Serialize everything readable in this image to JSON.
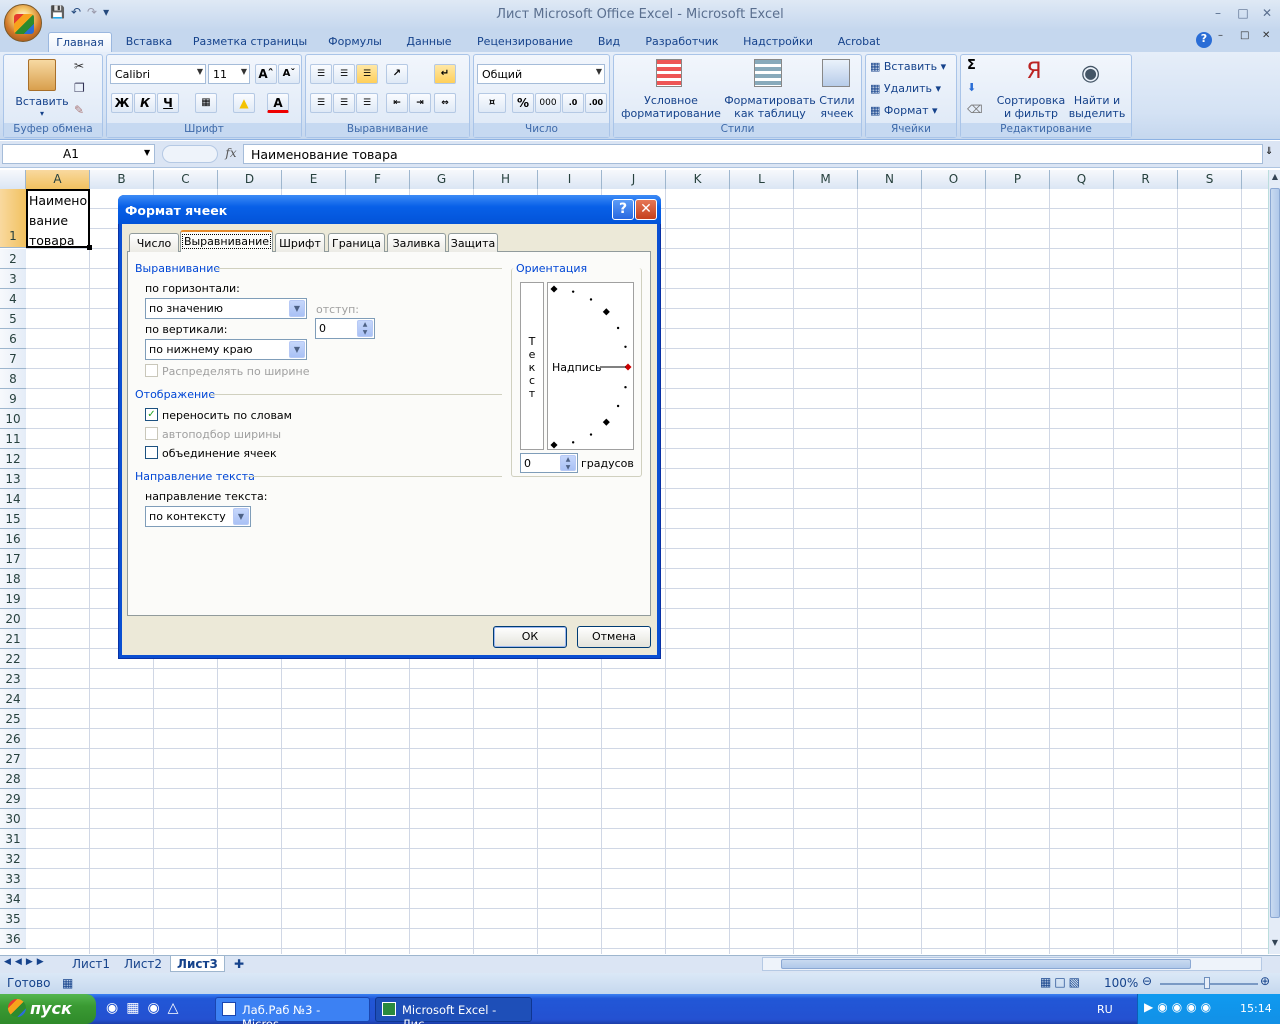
{
  "window": {
    "title": "Лист Microsoft Office Excel - Microsoft Excel"
  },
  "ribbon_tabs": [
    "Главная",
    "Вставка",
    "Разметка страницы",
    "Формулы",
    "Данные",
    "Рецензирование",
    "Вид",
    "Разработчик",
    "Надстройки",
    "Acrobat"
  ],
  "clipboard": {
    "paste": "Вставить",
    "label": "Буфер обмена"
  },
  "font": {
    "name": "Calibri",
    "size": "11",
    "bold": "Ж",
    "italic": "К",
    "underline": "Ч",
    "label": "Шрифт"
  },
  "alignment": {
    "label": "Выравнивание"
  },
  "number": {
    "format": "Общий",
    "percent": "%",
    "thousands": "000",
    "label": "Число"
  },
  "styles": {
    "conditional_l1": "Условное",
    "conditional_l2": "форматирование",
    "table_l1": "Форматировать",
    "table_l2": "как таблицу",
    "cell_l1": "Стили",
    "cell_l2": "ячеек",
    "label": "Стили"
  },
  "cells": {
    "insert": "Вставить",
    "delete": "Удалить",
    "format": "Формат",
    "label": "Ячейки"
  },
  "editing": {
    "sort_l1": "Сортировка",
    "sort_l2": "и фильтр",
    "find_l1": "Найти и",
    "find_l2": "выделить",
    "label": "Редактирование",
    "sum": "Σ"
  },
  "formula_bar": {
    "name": "A1",
    "fx": "fx",
    "value": "Наименование товара"
  },
  "columns": [
    "A",
    "B",
    "C",
    "D",
    "E",
    "F",
    "G",
    "H",
    "I",
    "J",
    "K",
    "L",
    "M",
    "N",
    "O",
    "P",
    "Q",
    "R",
    "S"
  ],
  "rows": [
    "1",
    "2",
    "3",
    "4",
    "5",
    "6",
    "7",
    "8",
    "9",
    "10",
    "11",
    "12",
    "13",
    "14",
    "15",
    "16",
    "17",
    "18",
    "19",
    "20",
    "21",
    "22",
    "23",
    "24",
    "25",
    "26",
    "27",
    "28",
    "29",
    "30",
    "31",
    "32",
    "33",
    "34",
    "35",
    "36"
  ],
  "cell_a1": {
    "line1": "Наимено",
    "line2": "вание",
    "line3": "товара"
  },
  "sheets": [
    "Лист1",
    "Лист2",
    "Лист3"
  ],
  "status": {
    "ready": "Готово",
    "zoom": "100%"
  },
  "dialog": {
    "title": "Формат ячеек",
    "tabs": [
      "Число",
      "Выравнивание",
      "Шрифт",
      "Граница",
      "Заливка",
      "Защита"
    ],
    "sec_align": "Выравнивание",
    "horiz_label": "по горизонтали:",
    "horiz_value": "по значению",
    "indent_label": "отступ:",
    "indent_value": "0",
    "vert_label": "по вертикали:",
    "vert_value": "по нижнему краю",
    "distribute": "Распределять по ширине",
    "sec_display": "Отображение",
    "wrap": "переносить по словам",
    "shrink": "автоподбор ширины",
    "merge": "объединение ячеек",
    "sec_dir": "Направление текста",
    "dir_label": "направление текста:",
    "dir_value": "по контексту",
    "sec_orient": "Ориентация",
    "vert_text": [
      "Т",
      "е",
      "к",
      "с",
      "т"
    ],
    "inscription": "Надпись",
    "degrees_value": "0",
    "degrees_label": "градусов",
    "ok": "ОК",
    "cancel": "Отмена"
  },
  "taskbar": {
    "start": "пуск",
    "task1": "Лаб.Раб №3 - Micros...",
    "task2": "Microsoft Excel - Лис...",
    "lang": "RU",
    "time": "15:14"
  }
}
